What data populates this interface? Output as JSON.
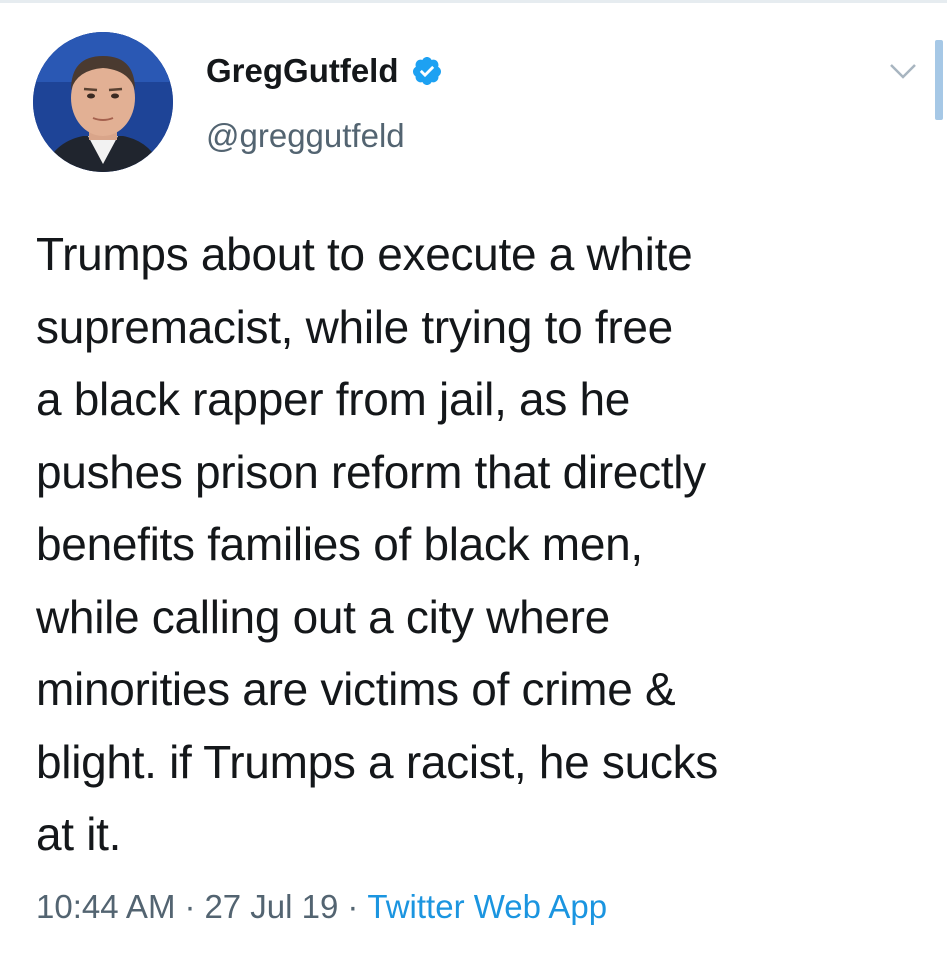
{
  "tweet": {
    "author": {
      "display_name": "GregGutfeld",
      "handle": "@greggutfeld",
      "verified": true,
      "avatar_icon": "user-avatar-photo"
    },
    "text": "Trumps about to execute a white\nsupremacist, while trying to free\na black rapper from jail, as he\npushes prison reform that directly\nbenefits families of black men,\nwhile calling out a city where\nminorities are victims of crime &\nblight. if Trumps a racist, he sucks\nat it.",
    "time": "10:44 AM",
    "date": "27 Jul 19",
    "separator": "·",
    "source": "Twitter Web App",
    "menu_icon": "chevron-down-icon",
    "verified_icon": "verified-badge-icon"
  },
  "colors": {
    "text": "#14171a",
    "secondary": "#536471",
    "link": "#1b95e0",
    "verified": "#1da1f2"
  }
}
